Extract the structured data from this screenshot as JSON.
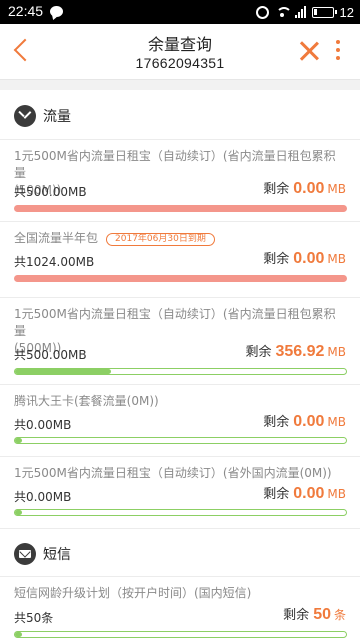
{
  "status_bar": {
    "time": "22:45",
    "battery": "12",
    "icons": [
      "chat-icon",
      "alarm-icon",
      "wifi-icon",
      "signal-icon",
      "battery-icon"
    ]
  },
  "header": {
    "title": "余量查询",
    "phone": "17662094351"
  },
  "colors": {
    "accent": "#f07a3c",
    "red_bar": "#f4968b",
    "green_bar": "#8ccf64"
  },
  "sections": {
    "traffic": {
      "title": "流量",
      "items": [
        {
          "name_line1": "1元500M省内流量日租宝（自动续订）(省内流量日租包累积量",
          "name_line2": "(500M))",
          "total": "共500.00MB",
          "remain_label": "剩余",
          "remain_value": "0.00",
          "remain_unit": "MB",
          "bar_style": "red",
          "used_fraction": 1.0
        },
        {
          "name_line1": "全国流量半年包",
          "badge": "2017年06月30日到期",
          "total": "共1024.00MB",
          "remain_label": "剩余",
          "remain_value": "0.00",
          "remain_unit": "MB",
          "bar_style": "red",
          "used_fraction": 1.0
        },
        {
          "name_line1": "1元500M省内流量日租宝（自动续订）(省内流量日租包累积量",
          "name_line2": "(500M))",
          "total": "共500.00MB",
          "remain_label": "剩余",
          "remain_value": "356.92",
          "remain_unit": "MB",
          "bar_style": "green",
          "used_fraction": 0.29
        },
        {
          "name_line1": "腾讯大王卡(套餐流量(0M))",
          "total": "共0.00MB",
          "remain_label": "剩余",
          "remain_value": "0.00",
          "remain_unit": "MB",
          "bar_style": "green",
          "used_fraction": 0.02
        },
        {
          "name_line1": "1元500M省内流量日租宝（自动续订）(省外国内流量(0M))",
          "total": "共0.00MB",
          "remain_label": "剩余",
          "remain_value": "0.00",
          "remain_unit": "MB",
          "bar_style": "green",
          "used_fraction": 0.02
        }
      ]
    },
    "sms": {
      "title": "短信",
      "items": [
        {
          "name_line1": "短信网龄升级计划（按开户时间）(国内短信)",
          "total": "共50条",
          "remain_label": "剩余",
          "remain_value": "50",
          "remain_unit": "条",
          "bar_style": "green",
          "used_fraction": 0.02
        }
      ]
    }
  }
}
